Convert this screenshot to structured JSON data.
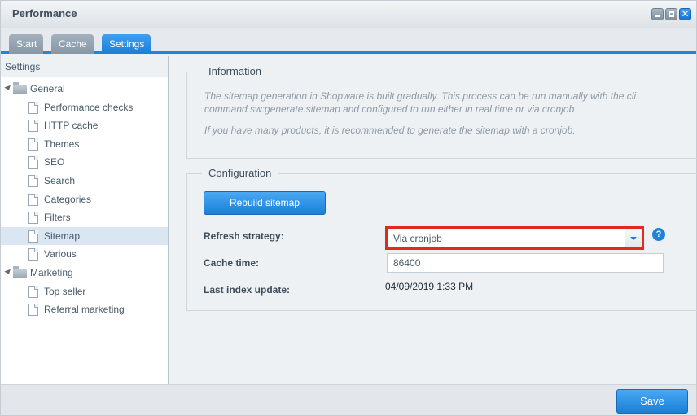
{
  "window": {
    "title": "Performance",
    "minimize_icon": "minimize-icon",
    "maximize_icon": "maximize-icon",
    "close_icon": "close-icon",
    "close_glyph": "✕"
  },
  "tabs": [
    {
      "label": "Start",
      "active": false
    },
    {
      "label": "Cache",
      "active": false
    },
    {
      "label": "Settings",
      "active": true
    }
  ],
  "sidebar": {
    "header": "Settings",
    "groups": [
      {
        "label": "General",
        "icon": "folder-icon",
        "items": [
          {
            "label": "Performance checks"
          },
          {
            "label": "HTTP cache"
          },
          {
            "label": "Themes"
          },
          {
            "label": "SEO"
          },
          {
            "label": "Search"
          },
          {
            "label": "Categories"
          },
          {
            "label": "Filters"
          },
          {
            "label": "Sitemap",
            "selected": true
          },
          {
            "label": "Various"
          }
        ]
      },
      {
        "label": "Marketing",
        "icon": "folder-icon",
        "items": [
          {
            "label": "Top seller"
          },
          {
            "label": "Referral marketing"
          }
        ]
      }
    ]
  },
  "information": {
    "legend": "Information",
    "text1": "The sitemap generation in Shopware is built gradually. This process can be run manually with the cli command sw:generate:sitemap and configured to run either in real time or via cronjob",
    "text2": "If you have many products, it is recommended to generate the sitemap with a cronjob."
  },
  "configuration": {
    "legend": "Configuration",
    "rebuild_label": "Rebuild sitemap",
    "refresh_strategy_label": "Refresh strategy:",
    "refresh_strategy_value": "Via cronjob",
    "help_glyph": "?",
    "cache_time_label": "Cache time:",
    "cache_time_value": "86400",
    "last_index_label": "Last index update:",
    "last_index_value": "04/09/2019 1:33 PM"
  },
  "footer": {
    "save_label": "Save"
  },
  "colors": {
    "accent": "#1e86db",
    "highlight_border": "#e22a1c",
    "selected_row": "#dae7f3"
  }
}
